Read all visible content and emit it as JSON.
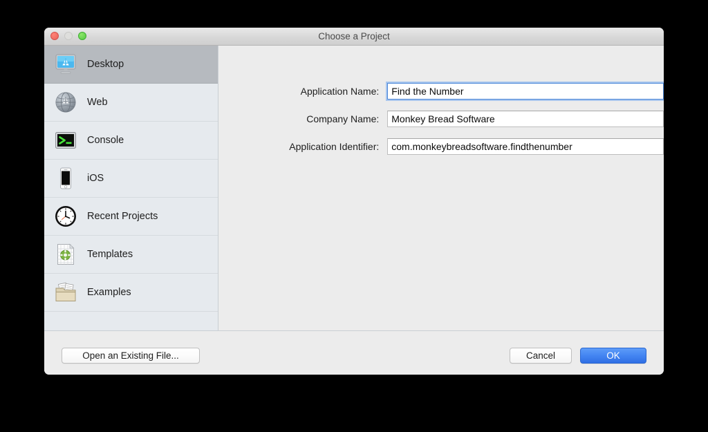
{
  "window": {
    "title": "Choose a Project",
    "traffic_lights": [
      {
        "name": "close",
        "color": "#e8635a"
      },
      {
        "name": "minimize",
        "color": "#dededc"
      },
      {
        "name": "zoom",
        "color": "#55c943"
      }
    ]
  },
  "sidebar": {
    "items": [
      {
        "label": "Desktop",
        "icon": "desktop-app-icon",
        "selected": true
      },
      {
        "label": "Web",
        "icon": "globe-app-icon",
        "selected": false
      },
      {
        "label": "Console",
        "icon": "terminal-icon",
        "selected": false
      },
      {
        "label": "iOS",
        "icon": "iphone-icon",
        "selected": false
      },
      {
        "label": "Recent Projects",
        "icon": "clock-icon",
        "selected": false
      },
      {
        "label": "Templates",
        "icon": "template-doc-icon",
        "selected": false
      },
      {
        "label": "Examples",
        "icon": "folder-papers-icon",
        "selected": false
      }
    ]
  },
  "form": {
    "fields": [
      {
        "label": "Application Name:",
        "value": "Find the Number",
        "placeholder": "",
        "focused": true
      },
      {
        "label": "Company Name:",
        "value": "Monkey Bread Software",
        "placeholder": "",
        "focused": false
      },
      {
        "label": "Application Identifier:",
        "value": "com.monkeybreadsoftware.findthenumber",
        "placeholder": "",
        "focused": false
      }
    ]
  },
  "footer": {
    "open_existing_label": "Open an Existing File...",
    "cancel_label": "Cancel",
    "ok_label": "OK"
  },
  "colors": {
    "default_button": "#2f6fe4",
    "focus_ring": "#a8c6ee",
    "sidebar_bg": "#e6eaee",
    "sidebar_selected": "#b6babf",
    "panel_bg": "#ececec"
  }
}
